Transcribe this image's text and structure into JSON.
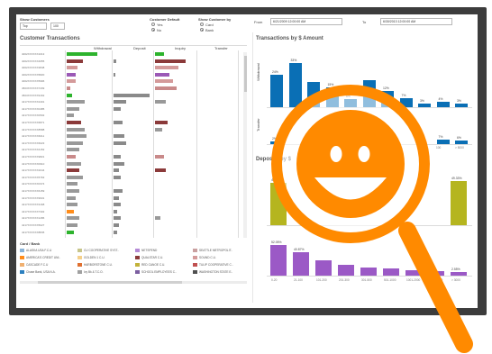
{
  "filters": {
    "show_customers_label": "Show Customers",
    "top_value": "Top",
    "count_value": "100",
    "customer_default_label": "Customer Default",
    "default_yes": "Yes",
    "default_no": "No",
    "show_customer_by_label": "Show Customer by",
    "by_card": "Card",
    "by_bank": "Bank",
    "from_label": "From",
    "from_value": "6/21/2009 12:00:00 AM",
    "to_label": "To",
    "to_value": "6/30/2013 12:00:00 AM"
  },
  "left_panel": {
    "title": "Customer Transactions",
    "columns": [
      "Withdrawal",
      "Deposit",
      "Inquiry",
      "Transfer"
    ],
    "accounts": [
      "4002XXXXXX1013",
      "4002XXXXXX4655",
      "4002XXXXXX3848",
      "4002XXXXXX5820",
      "4002XXXXXX5996",
      "4503XXXXXX7209",
      "4503XXXXXX9162",
      "4217XXXXXX2401",
      "4217XXXXXX0485",
      "4217XXXXXX0502",
      "4217XXXXXX6871",
      "4217XXXXXX8588",
      "4217XXXXXX6011",
      "4217XXXXXX6023",
      "4217XXXXXX4152",
      "4217XXXXXX9821",
      "4217XXXXXX0910",
      "4217XXXXXX2044",
      "4217XXXXXX5763",
      "4217XXXXXX0374",
      "4217XXXXXX6159",
      "4217XXXXXX9931",
      "4217XXXXXX3168",
      "4217XXXXXX7302",
      "4217XXXXXX1286",
      "4217XXXXXX5027",
      "4217XXXXXX8845"
    ],
    "bars": [
      {
        "w": 34,
        "d": 0,
        "i": 10,
        "color": "#2db32d"
      },
      {
        "w": 18,
        "d": 3,
        "i": 34,
        "color": "#8b3a3a"
      },
      {
        "w": 12,
        "d": 0,
        "i": 26,
        "color": "#d49a9a"
      },
      {
        "w": 10,
        "d": 2,
        "i": 16,
        "color": "#9b59b6"
      },
      {
        "w": 10,
        "d": 0,
        "i": 20,
        "color": "#d49a9a"
      },
      {
        "w": 4,
        "d": 0,
        "i": 24,
        "color": "#c98a8a"
      },
      {
        "w": 6,
        "d": 40,
        "i": 0,
        "color": "#2db32d"
      },
      {
        "w": 20,
        "d": 14,
        "i": 12,
        "color": "#999999"
      },
      {
        "w": 14,
        "d": 8,
        "i": 0,
        "color": "#999999"
      },
      {
        "w": 8,
        "d": 0,
        "i": 0,
        "color": "#999999"
      },
      {
        "w": 16,
        "d": 10,
        "i": 14,
        "color": "#8b3a3a"
      },
      {
        "w": 20,
        "d": 0,
        "i": 8,
        "color": "#999999"
      },
      {
        "w": 22,
        "d": 12,
        "i": 0,
        "color": "#999999"
      },
      {
        "w": 18,
        "d": 14,
        "i": 0,
        "color": "#999999"
      },
      {
        "w": 14,
        "d": 0,
        "i": 0,
        "color": "#999999"
      },
      {
        "w": 10,
        "d": 8,
        "i": 10,
        "color": "#c98a8a"
      },
      {
        "w": 16,
        "d": 12,
        "i": 0,
        "color": "#999999"
      },
      {
        "w": 14,
        "d": 6,
        "i": 12,
        "color": "#8b3a3a"
      },
      {
        "w": 18,
        "d": 8,
        "i": 0,
        "color": "#999999"
      },
      {
        "w": 12,
        "d": 0,
        "i": 0,
        "color": "#999999"
      },
      {
        "w": 14,
        "d": 10,
        "i": 0,
        "color": "#999999"
      },
      {
        "w": 10,
        "d": 6,
        "i": 0,
        "color": "#999999"
      },
      {
        "w": 12,
        "d": 8,
        "i": 0,
        "color": "#999999"
      },
      {
        "w": 8,
        "d": 4,
        "i": 0,
        "color": "#ff8c1a"
      },
      {
        "w": 14,
        "d": 8,
        "i": 6,
        "color": "#999999"
      },
      {
        "w": 12,
        "d": 6,
        "i": 0,
        "color": "#999999"
      },
      {
        "w": 8,
        "d": 4,
        "i": 0,
        "color": "#2db32d"
      }
    ],
    "legend_title": "Card / Bank",
    "legend": [
      {
        "name": "ALASKA USA F.C.U",
        "color": "#8ab4d8"
      },
      {
        "name": "CU COOPERATIVE SYST..",
        "color": "#c7c58a"
      },
      {
        "name": "NETSPEND",
        "color": "#b58ad6"
      },
      {
        "name": "SEATTLE METROPOLIT..",
        "color": "#c9a0a0"
      },
      {
        "name": "AMERICA'S CREDIT UNI..",
        "color": "#ff8c1a"
      },
      {
        "name": "GOLDEN 1 C.U.",
        "color": "#f5d08a"
      },
      {
        "name": "QUALSTAR C.U.",
        "color": "#8b3a3a"
      },
      {
        "name": "SOUND C.U.",
        "color": "#d49a9a"
      },
      {
        "name": "CASCADE F.C.U",
        "color": "#f0b070"
      },
      {
        "name": "HARBORSTONE C.U.",
        "color": "#e07030"
      },
      {
        "name": "RED CANOE C.U.",
        "color": "#c2b23a"
      },
      {
        "name": "TULIP COOPERATIVE C..",
        "color": "#c05050"
      },
      {
        "name": "Chase Bank, USA N.A.",
        "color": "#2b7fbf"
      },
      {
        "name": "Ivy Bk & T.C.O.",
        "color": "#a0a0a0"
      },
      {
        "name": "SCHOOL EMPLOYEES C..",
        "color": "#7b5ea0"
      },
      {
        "name": "WASHINGTON STATE E..",
        "color": "#505050"
      }
    ]
  },
  "right_top": {
    "title": "Transactions by $ Amount",
    "row1_label": "Withdrawal",
    "row2_label": "Transfer",
    "bins": [
      "0-20",
      "21-100",
      "101-200",
      "201-300",
      "301-500",
      "501-1000",
      "1001-2000",
      "2001-3000",
      "3001-4000",
      "4001-5000",
      "> 5000"
    ],
    "withdrawal_pct": [
      24,
      33,
      19,
      15,
      6,
      20,
      12,
      7,
      3,
      4,
      3
    ],
    "withdrawal_labels": [
      "24%",
      "33%",
      "",
      "15%",
      "6%",
      "",
      "12%",
      "7%",
      "3%",
      "4%",
      "3%"
    ],
    "transfer_pct": [
      4,
      0,
      0,
      0,
      0,
      0,
      0,
      0,
      0,
      7,
      6
    ],
    "transfer_labels": [
      "2%",
      "",
      "",
      "",
      "",
      "",
      "",
      "",
      "",
      "7%",
      "6%"
    ],
    "transfer_ticks": [
      "100",
      "> 5000"
    ]
  },
  "right_bottom": {
    "title": "Deposits by $",
    "row1_pct": [
      47,
      0,
      0,
      0,
      0,
      0,
      0,
      0,
      49
    ],
    "row1_labels": [
      "47.5%",
      "",
      "",
      "",
      "",
      "",
      "",
      "",
      "49.33%"
    ],
    "row2_pct": [
      52,
      40,
      26,
      18,
      14,
      12,
      10,
      8,
      6
    ],
    "row2_labels": [
      "52.05%",
      "40.87%",
      "",
      "",
      "",
      "",
      "",
      "",
      "2.55%"
    ],
    "bins": [
      "0-20",
      "21-100",
      "101-200",
      "201-300",
      "301-500",
      "501-1000",
      "1001-2000",
      "2001-3000",
      "> 3000"
    ]
  },
  "colors": {
    "blue": "#0a6fb5",
    "olive": "#b5b51f",
    "purple": "#9b59c6",
    "orange": "#ff8a00"
  },
  "overlay_icon": "magnifying-glass-smiley-icon"
}
